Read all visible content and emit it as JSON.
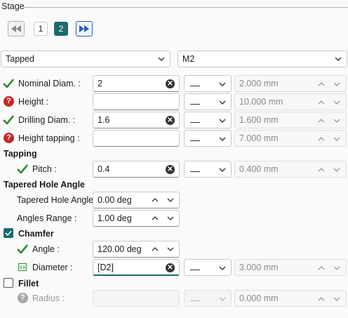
{
  "stage": {
    "title": "Stage",
    "pages": [
      "1",
      "2"
    ]
  },
  "hole_type": {
    "value": "Tapped",
    "options": [
      "Tapped"
    ]
  },
  "thread": {
    "value": "M2"
  },
  "unit_dash": "__",
  "rows": {
    "nominal": {
      "label": "Nominal Diam. :",
      "value": "2",
      "computed": "2.000 mm"
    },
    "height": {
      "label": "Height :",
      "value": "",
      "computed": "10.000 mm"
    },
    "drilling": {
      "label": "Drilling Diam. :",
      "value": "1.6",
      "computed": "1.600 mm"
    },
    "height_tapping": {
      "label": "Height tapping :",
      "value": "",
      "computed": "7.000 mm"
    }
  },
  "tapping": {
    "title": "Tapping",
    "pitch": {
      "label": "Pitch :",
      "value": "0.4",
      "computed": "0.400 mm"
    }
  },
  "tapered": {
    "title": "Tapered Hole Angle",
    "angle": {
      "label": "Tapered Hole Angle",
      "value": "0.00 deg"
    },
    "range": {
      "label": "Angles Range :",
      "value": "1.00 deg"
    }
  },
  "chamfer": {
    "title": "Chamfer",
    "checked": true,
    "angle": {
      "label": "Angle :",
      "value": "120.00 deg"
    },
    "diameter": {
      "label": "Diameter :",
      "value": "[D2]",
      "computed": "3.000 mm"
    }
  },
  "fillet": {
    "title": "Fillet",
    "checked": false,
    "radius": {
      "label": "Radius :",
      "value": "",
      "computed": "0.000 mm"
    }
  },
  "icons": {
    "clear": "clear-icon",
    "check": "check-icon",
    "error": "error-icon",
    "fx": "formula-icon"
  },
  "colors": {
    "accent": "#1b6b6b",
    "check": "#2e8b2e",
    "error": "#c42828"
  }
}
